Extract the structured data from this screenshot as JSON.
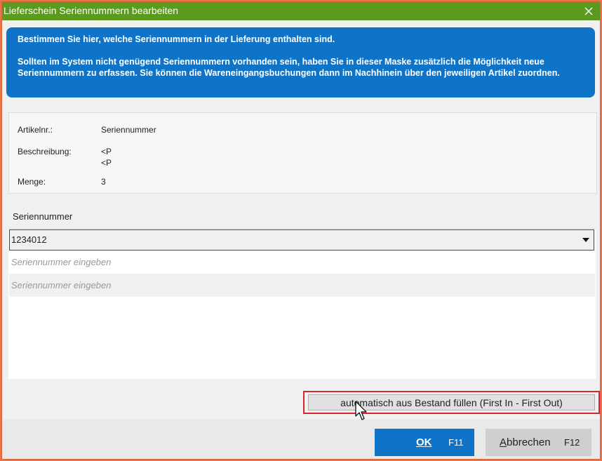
{
  "window": {
    "title": "Lieferschein Seriennummern bearbeiten",
    "close_icon": "close-icon"
  },
  "info": {
    "line1": "Bestimmen Sie hier, welche Seriennummern in der Lieferung enthalten sind.",
    "line2": "Sollten im System nicht genügend Seriennummern vorhanden sein, haben Sie in dieser Maske zusätzlich die Möglichkeit neue Seriennummern zu erfassen. Sie können die Wareneingangsbuchungen dann im Nachhinein über den jeweiligen Artikel zuordnen."
  },
  "details": {
    "article_label": "Artikelnr.:",
    "article_value": "Seriennummer",
    "description_label": "Beschreibung:",
    "description_value_1": "<P",
    "description_value_2": "<P",
    "quantity_label": "Menge:",
    "quantity_value": "3"
  },
  "grid": {
    "header": "Seriennummer",
    "rows": [
      {
        "value": "1234012"
      },
      {
        "placeholder": "Seriennummer eingeben"
      },
      {
        "placeholder": "Seriennummer eingeben"
      }
    ]
  },
  "auto_fill_button": "automatisch aus Bestand füllen (First In - First Out)",
  "footer": {
    "ok_label": "OK",
    "ok_key": "F11",
    "cancel_label_first": "A",
    "cancel_label_rest": "bbrechen",
    "cancel_key": "F12"
  },
  "colors": {
    "titlebar": "#5c9a1f",
    "info_box": "#0f74c7",
    "ok_button": "#0f74c7",
    "highlight_border": "#d9272c",
    "window_frame": "#e8734f"
  }
}
